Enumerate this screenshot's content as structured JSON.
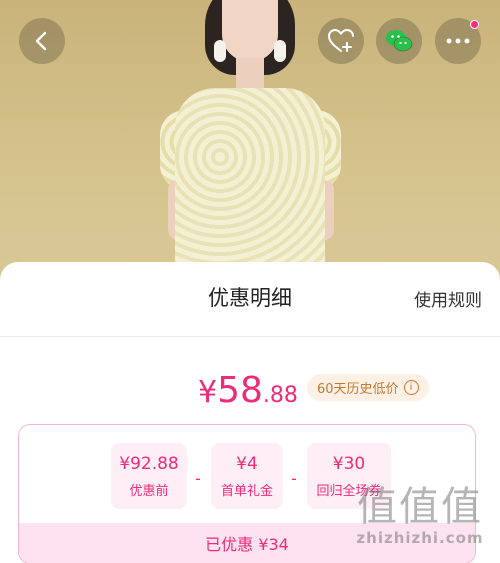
{
  "header": {
    "back_icon": "chevron-left-icon",
    "wishlist_icon": "heart-plus-icon",
    "share_icon": "wechat-icon",
    "more_icon": "more-dots-icon",
    "badge_color": "#ff2a8a"
  },
  "sheet": {
    "title": "优惠明细",
    "rules_label": "使用规则"
  },
  "price": {
    "currency": "¥",
    "integer": "58",
    "decimal": ".88",
    "badge_label": "60天历史低价",
    "accent_color": "#ee2a7b"
  },
  "breakdown": {
    "original": {
      "amount": "¥92.88",
      "label": "优惠前"
    },
    "first_order": {
      "amount": "¥4",
      "label": "首单礼金"
    },
    "return": {
      "amount": "¥30",
      "label": "回归全场券"
    },
    "operator": "-",
    "saved_label": "已优惠 ¥34"
  },
  "watermark": {
    "glyphs": "值值值",
    "url": "zhizhizhi.com"
  }
}
